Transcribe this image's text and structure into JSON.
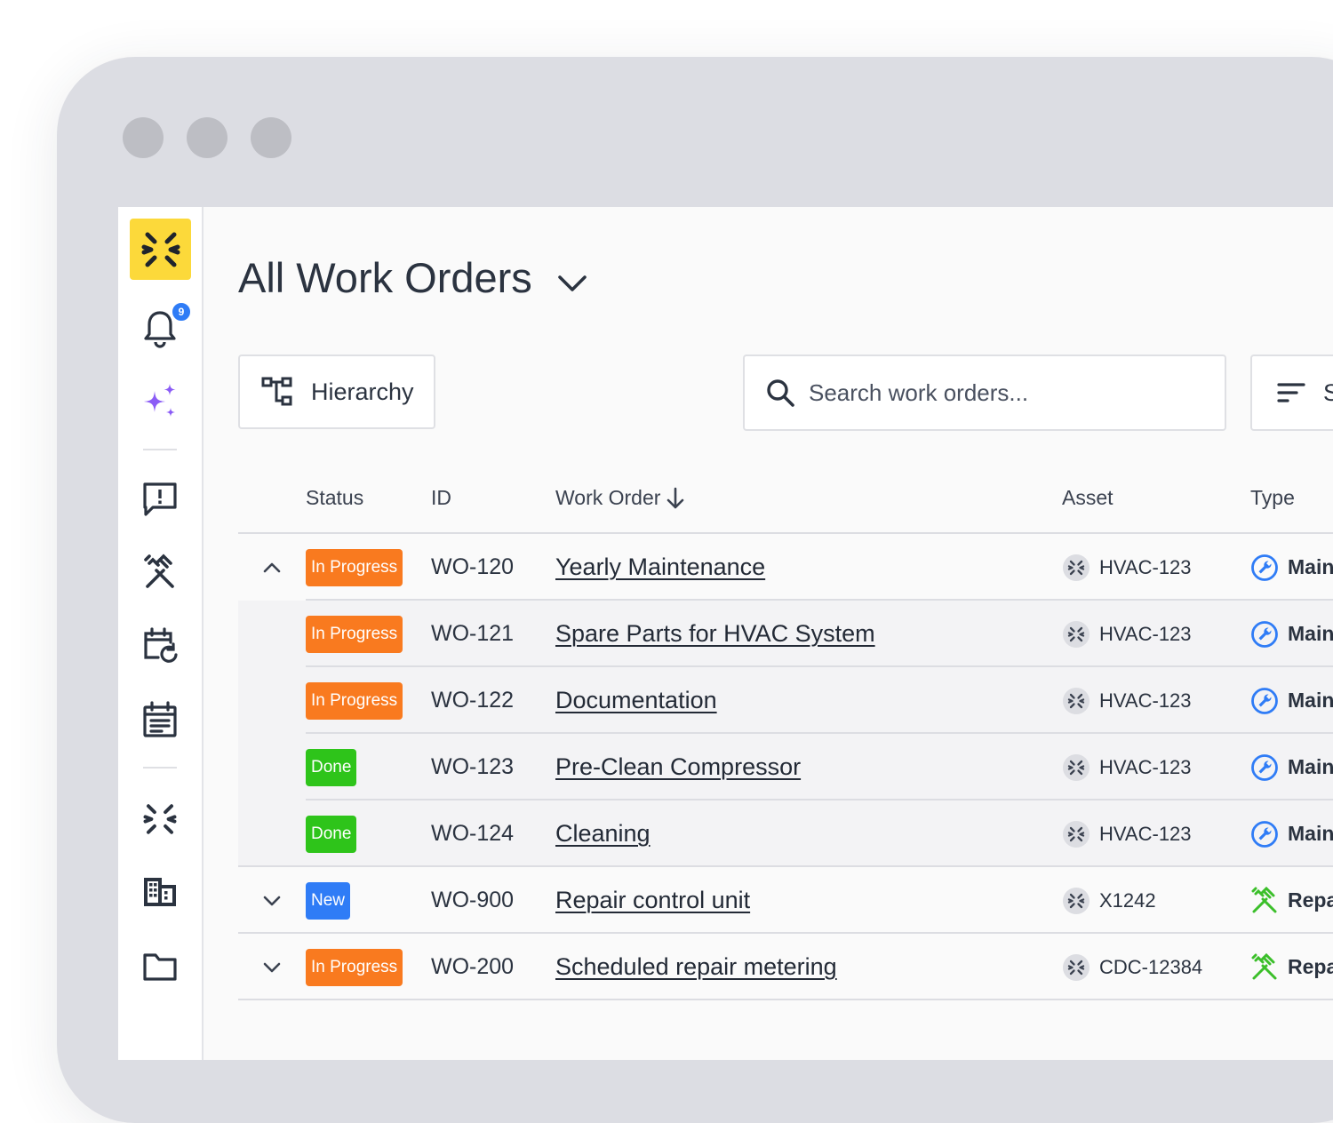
{
  "sidebar": {
    "notification_count": "9",
    "items": [
      {
        "name": "notifications",
        "icon": "bell-icon"
      },
      {
        "name": "ai-assistant",
        "icon": "sparkles-icon"
      },
      {
        "name": "requests",
        "icon": "message-alert-icon"
      },
      {
        "name": "work-orders",
        "icon": "tools-icon"
      },
      {
        "name": "recurring",
        "icon": "calendar-refresh-icon"
      },
      {
        "name": "schedule",
        "icon": "calendar-list-icon"
      },
      {
        "name": "assets",
        "icon": "asset-x-icon"
      },
      {
        "name": "locations",
        "icon": "building-icon"
      },
      {
        "name": "files",
        "icon": "folder-icon"
      }
    ]
  },
  "header": {
    "title": "All Work Orders"
  },
  "toolbar": {
    "hierarchy_label": "Hierarchy",
    "search_placeholder": "Search work orders...",
    "sort_label": "S"
  },
  "table": {
    "columns": {
      "status": "Status",
      "id": "ID",
      "work_order": "Work Order",
      "asset": "Asset",
      "type": "Type"
    },
    "rows": [
      {
        "expander": "up",
        "child": false,
        "status": "In Progress",
        "status_color": "#f97a1f",
        "id": "WO-120",
        "title": "Yearly Maintenance",
        "asset": "HVAC-123",
        "type": "Main",
        "type_kind": "maintenance"
      },
      {
        "expander": "",
        "child": true,
        "status": "In Progress",
        "status_color": "#f97a1f",
        "id": "WO-121",
        "title": "Spare Parts for HVAC System",
        "asset": "HVAC-123",
        "type": "Main",
        "type_kind": "maintenance"
      },
      {
        "expander": "",
        "child": true,
        "status": "In Progress",
        "status_color": "#f97a1f",
        "id": "WO-122",
        "title": "Documentation",
        "asset": "HVAC-123",
        "type": "Main",
        "type_kind": "maintenance"
      },
      {
        "expander": "",
        "child": true,
        "status": "Done",
        "status_color": "#2ec41a",
        "id": "WO-123",
        "title": "Pre-Clean Compressor",
        "asset": "HVAC-123",
        "type": "Main",
        "type_kind": "maintenance"
      },
      {
        "expander": "",
        "child": true,
        "status": "Done",
        "status_color": "#2ec41a",
        "id": "WO-124",
        "title": "Cleaning",
        "asset": "HVAC-123",
        "type": "Main",
        "type_kind": "maintenance"
      },
      {
        "expander": "down",
        "child": false,
        "status": "New",
        "status_color": "#2f7cf6",
        "id": "WO-900",
        "title": "Repair control unit",
        "asset": "X1242",
        "type": "Repa",
        "type_kind": "repair"
      },
      {
        "expander": "down",
        "child": false,
        "status": "In Progress",
        "status_color": "#f97a1f",
        "id": "WO-200",
        "title": "Scheduled repair metering",
        "asset": "CDC-12384",
        "type": "Repa",
        "type_kind": "repair"
      }
    ]
  },
  "colors": {
    "brand_yellow": "#fcd93a",
    "in_progress": "#f97a1f",
    "done": "#2ec41a",
    "new": "#2f7cf6",
    "maintenance_blue": "#2f7cf6",
    "repair_green": "#3bbf2a",
    "ai_purple": "#8b5cf6"
  }
}
